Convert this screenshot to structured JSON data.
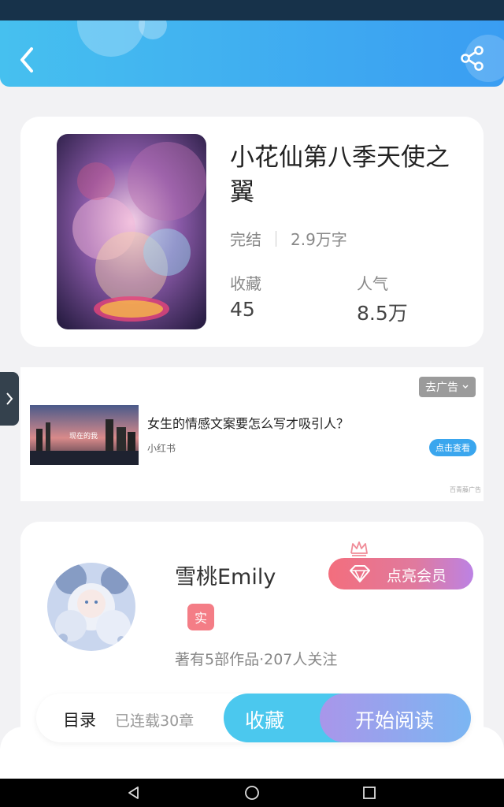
{
  "book": {
    "title": "小花仙第八季天使之翼",
    "status": "完结",
    "word_count": "2.9万字",
    "favorites_label": "收藏",
    "favorites_value": "45",
    "popularity_label": "人气",
    "popularity_value": "8.5万"
  },
  "ad": {
    "close_label": "去广告",
    "headline": "女生的情感文案要怎么写才吸引人？",
    "source": "小红书",
    "cta_label": "点击查看",
    "brand_label": "百青藤广告",
    "image_caption": "现在的我"
  },
  "author": {
    "name": "雪桃Emily",
    "badge": "实",
    "info": "著有5部作品·207人关注",
    "vip_button": "点亮会员"
  },
  "actions": {
    "toc_label": "目录",
    "chapters_label": "已连载30章",
    "collect_button": "收藏",
    "read_button": "开始阅读"
  },
  "icons": {
    "back": "chevron-left-icon",
    "share": "share-icon",
    "expand": "chevron-right-icon",
    "vip": "diamond-icon",
    "crown": "crown-icon",
    "nav_back": "triangle-back-icon",
    "nav_home": "circle-home-icon",
    "nav_recent": "square-recent-icon"
  },
  "colors": {
    "header_start": "#46c0ef",
    "header_end": "#3a9df2",
    "accent_blue": "#4bc8ee",
    "vip_pink": "#f36e7d",
    "badge_red": "#f47d86"
  }
}
